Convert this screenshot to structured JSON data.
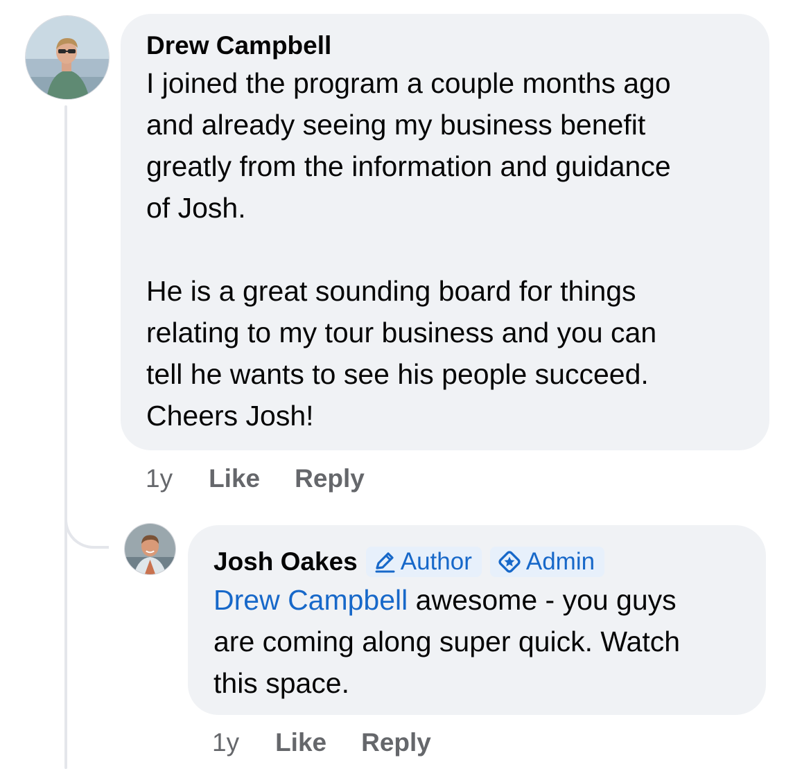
{
  "comments": [
    {
      "author": "Drew Campbell",
      "paragraphs": [
        [
          "I joined the program a couple months ago",
          "and already seeing my business benefit",
          "greatly from the information and guidance",
          "of Josh."
        ],
        [
          "He is a great sounding board for things",
          "relating to my tour business and you can",
          "tell he wants to see his people succeed.",
          "Cheers Josh!"
        ]
      ],
      "time": "1y",
      "like_label": "Like",
      "reply_label": "Reply"
    }
  ],
  "reply": {
    "author": "Josh Oakes",
    "badges": [
      {
        "label": "Author",
        "icon": "pencil-icon"
      },
      {
        "label": "Admin",
        "icon": "admin-star-icon"
      }
    ],
    "mention": "Drew Campbell",
    "lines": [
      " awesome - you guys",
      "are coming along super quick. Watch",
      "this space."
    ],
    "time": "1y",
    "like_label": "Like",
    "reply_label": "Reply"
  },
  "colors": {
    "bubble": "#f0f2f5",
    "link_blue": "#1768c9",
    "meta_gray": "#65676b",
    "text": "#050505"
  }
}
